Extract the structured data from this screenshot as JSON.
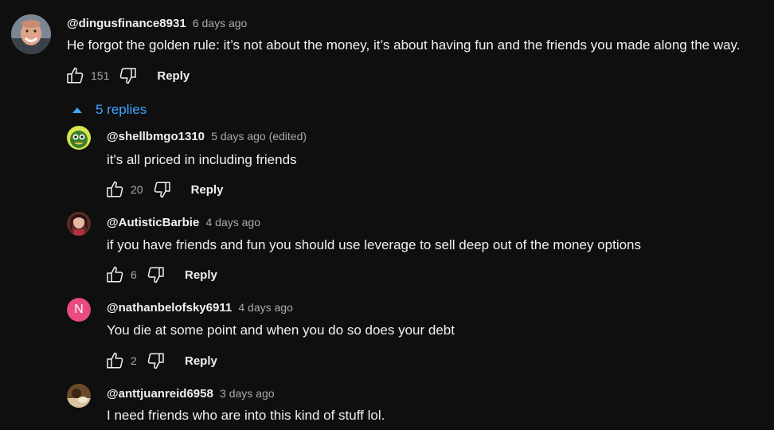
{
  "top_comment": {
    "handle": "@dingusfinance8931",
    "time": "6 days ago",
    "text": "He forgot the golden rule: it’s not about the money, it’s about having fun and the friends you made along the way.",
    "likes": "151",
    "reply_label": "Reply"
  },
  "replies_toggle": {
    "label": "5 replies",
    "icon": "chevron-up-icon"
  },
  "replies": [
    {
      "handle": "@shellbmgo1310",
      "time": "5 days ago (edited)",
      "text": "it's all priced in including friends",
      "likes": "20",
      "reply_label": "Reply"
    },
    {
      "handle": "@AutisticBarbie",
      "time": "4 days ago",
      "text": "if you have friends and fun you should use leverage to sell deep out of the money options",
      "likes": "6",
      "reply_label": "Reply"
    },
    {
      "handle": "@nathanbelofsky6911",
      "time": "4 days ago",
      "text": "You die at some point and when you do so does your debt",
      "likes": "2",
      "reply_label": "Reply",
      "avatar_letter": "N",
      "avatar_color": "#e94a7f"
    },
    {
      "handle": "@anttjuanreid6958",
      "time": "3 days ago",
      "text": "I need friends who are into this kind of stuff lol."
    }
  ],
  "colors": {
    "background": "#0f0f0f",
    "text": "#f1f1f1",
    "secondary": "#aaaaaa",
    "link": "#3ea6ff"
  }
}
